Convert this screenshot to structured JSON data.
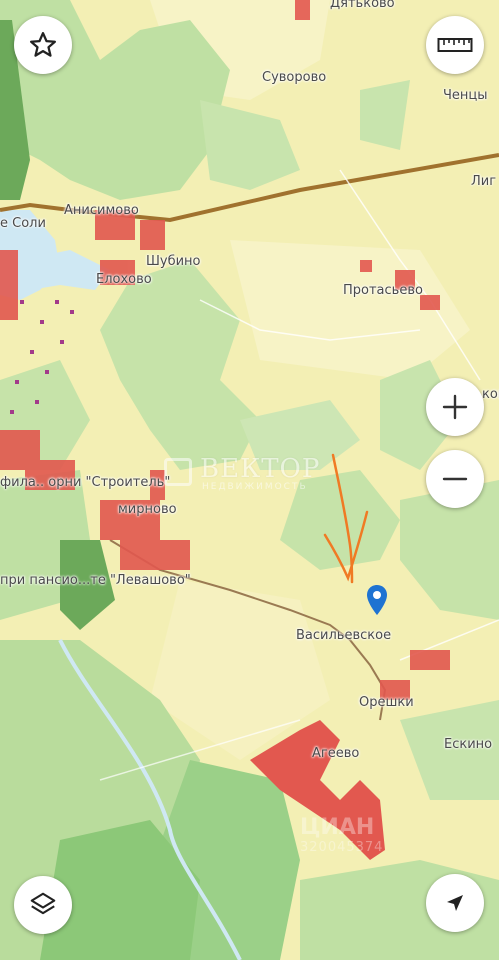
{
  "map": {
    "places": [
      {
        "id": "dyakovo",
        "name": "Дятьково"
      },
      {
        "id": "suvorovo",
        "name": "Суворово"
      },
      {
        "id": "chentsy",
        "name": "Ченцы"
      },
      {
        "id": "lig",
        "name": "Лиг"
      },
      {
        "id": "anisimovo",
        "name": "Анисимово"
      },
      {
        "id": "soli",
        "name": "е Соли"
      },
      {
        "id": "shubino",
        "name": "Шубино"
      },
      {
        "id": "elokhovo",
        "name": "Елохово"
      },
      {
        "id": "protasevo",
        "name": "Протасьево"
      },
      {
        "id": "kovo",
        "name": "ково"
      },
      {
        "id": "stroitel",
        "name": "фила.. орни \"Строитель\""
      },
      {
        "id": "smirnovo",
        "name": "мирново"
      },
      {
        "id": "levashovo",
        "name": "при пансио...те \"Левашово\""
      },
      {
        "id": "vasilevskoe",
        "name": "Васильевское"
      },
      {
        "id": "oreshki",
        "name": "Орешки"
      },
      {
        "id": "eskino",
        "name": "Ескино"
      },
      {
        "id": "ageevo",
        "name": "Агеево"
      }
    ],
    "watermark": {
      "brand": "ВЕКТОР",
      "sub": "НЕДВИЖИМОСТЬ"
    },
    "watermark2": {
      "brand": "ЦИАН",
      "code": "320045374"
    }
  },
  "controls": {
    "favorite": "star-icon",
    "ruler": "ruler-icon",
    "zoom_in": "plus-icon",
    "zoom_out": "minus-icon",
    "layers": "layers-icon",
    "locate": "navigation-arrow-icon"
  },
  "colors": {
    "land": "#f3efb4",
    "forest": "#bfe0a3",
    "dark_forest": "#8cc878",
    "water": "#cfe8f3",
    "road": "#a0722e",
    "settlement": "#e2584f",
    "marker": "#1e73d2",
    "annotation": "#f07a24"
  }
}
